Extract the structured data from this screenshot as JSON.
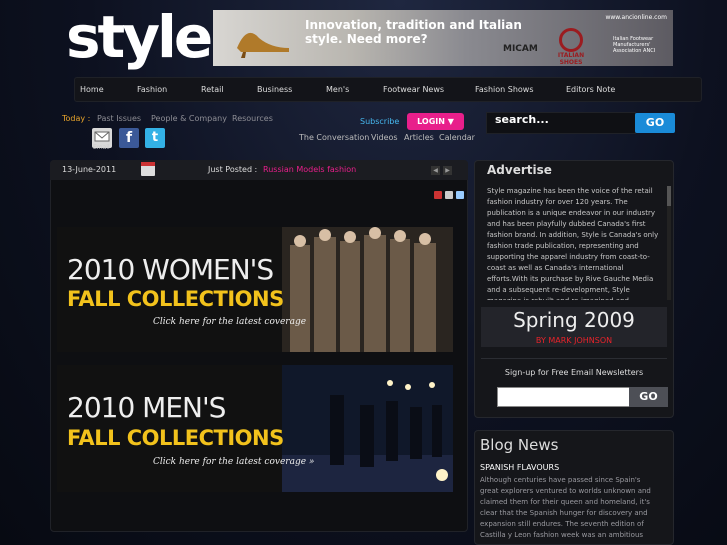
{
  "site": {
    "logo": "style"
  },
  "banner": {
    "headline": "Innovation, tradition and Italian style. Need more?",
    "url": "www.ancionline.com",
    "micam": "MICAM",
    "italian_shoes": "ITALIAN SHOES",
    "association": "Italian Footwear Manufacturers' Association ANCI"
  },
  "nav": {
    "items": [
      {
        "label": "Home"
      },
      {
        "label": "Fashion"
      },
      {
        "label": "Retail"
      },
      {
        "label": "Business"
      },
      {
        "label": "Men's"
      },
      {
        "label": "Footwear News"
      },
      {
        "label": "Fashion Shows"
      },
      {
        "label": "Editors Note"
      }
    ]
  },
  "subnav": {
    "today": "Today :",
    "links": [
      "Past Issues",
      "People & Company",
      "Resources"
    ],
    "subscribe": "Subscribe",
    "login": "LOGIN",
    "secondary": [
      "The Conversation",
      "Videos",
      "Articles",
      "Calendar"
    ],
    "email_label": "Email"
  },
  "search": {
    "value": "search...",
    "button": "GO"
  },
  "main": {
    "date": "13-June-2011",
    "just_posted_label": "Just Posted :",
    "just_posted_link": "Russian Models fashion",
    "promos": [
      {
        "line1": "2010 WOMEN'S",
        "line2": "FALL COLLECTIONS",
        "cta": "Click here for the latest coverage"
      },
      {
        "line1": "2010 MEN'S",
        "line2": "FALL COLLECTIONS",
        "cta": "Click here for the latest coverage »"
      }
    ]
  },
  "sidebar": {
    "advertise_title": "Advertise",
    "advertise_text": "Style magazine has been the voice of the retail fashion industry for over 120 years. The publication is a unique endeavor in our industry and has been playfully dubbed Canada's first fashion brand. In addition, Style is Canada's only fashion trade publication, representing and supporting the apparel industry from coast-to-coast as well as Canada's international efforts.With its purchase by Rive Gauche Media and a subsequent re-development, Style magazine is rebuilt and re-imagined and continues to embody",
    "spring_title": "Spring 2009",
    "spring_byline": "BY MARK JOHNSON",
    "newsletter_label": "Sign-up for Free Email Newsletters",
    "newsletter_button": "GO",
    "blog_title": "Blog News",
    "blog_subtitle": "SPANISH FLAVOURS",
    "blog_text": "Although centuries have passed since Spain's great explorers ventured to worlds unknown and claimed them for their queen and homeland, it's clear that the Spanish hunger for discovery and expansion still endures. The seventh edition of Castilla y Leon fashion week was an ambitious"
  },
  "colors": {
    "accent_pink": "#e81f8b",
    "accent_blue": "#1a8bd8",
    "today_orange": "#e8a42b",
    "promo_yellow": "#f2c21c"
  }
}
